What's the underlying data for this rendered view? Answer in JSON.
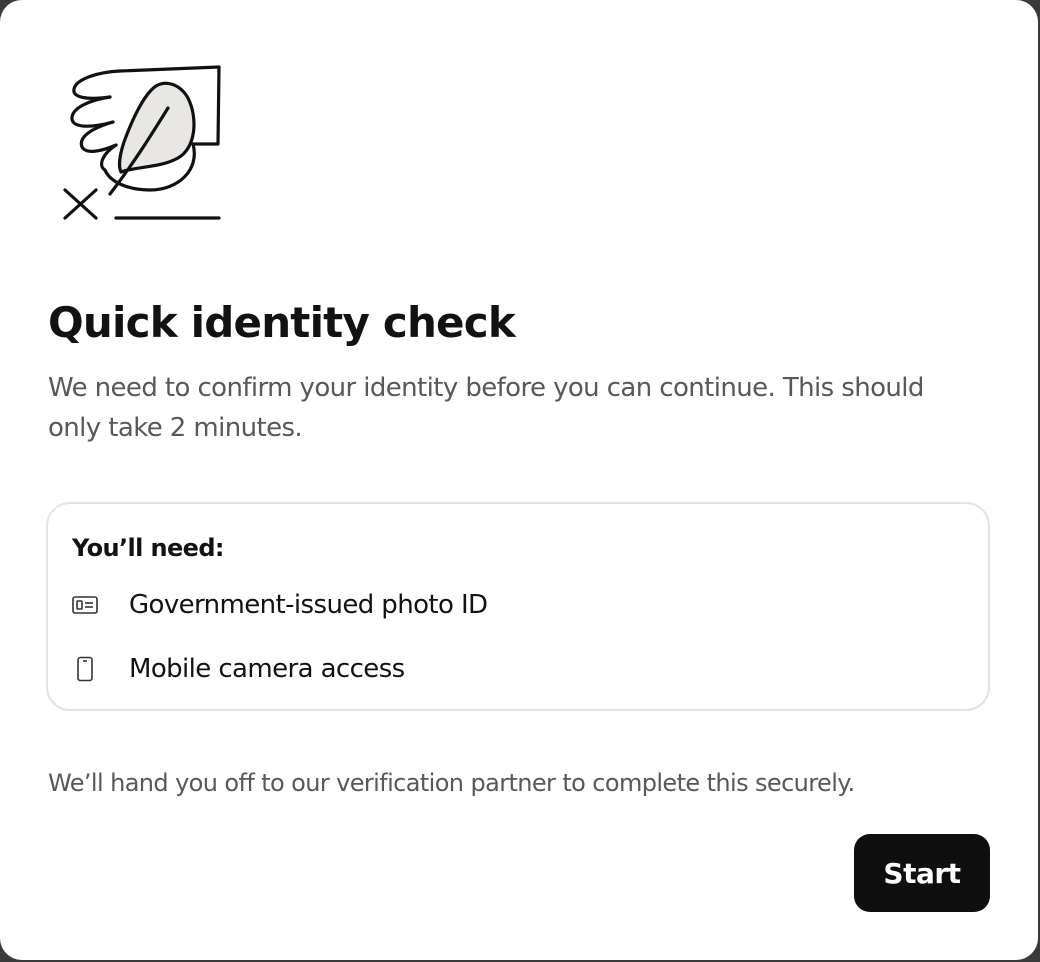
{
  "dialog": {
    "title": "Quick identity check",
    "intro": "We need to confirm your identity before you can continue. This should only take 2 minutes.",
    "illustration_icon": "quill-signature-illustration",
    "needs": {
      "heading": "You’ll need:",
      "items": [
        {
          "icon": "id-card-icon",
          "label": "Government-issued photo ID"
        },
        {
          "icon": "mobile-phone-icon",
          "label": "Mobile camera access"
        }
      ]
    },
    "footnote": "We’ll hand you off to our verification partner to complete this securely.",
    "start_label": "Start"
  },
  "colors": {
    "background": "#ffffff",
    "title": "#121212",
    "body_text": "#585858",
    "card_border": "#e3e3e3",
    "button_bg": "#0f0f0f",
    "button_text": "#ffffff"
  }
}
